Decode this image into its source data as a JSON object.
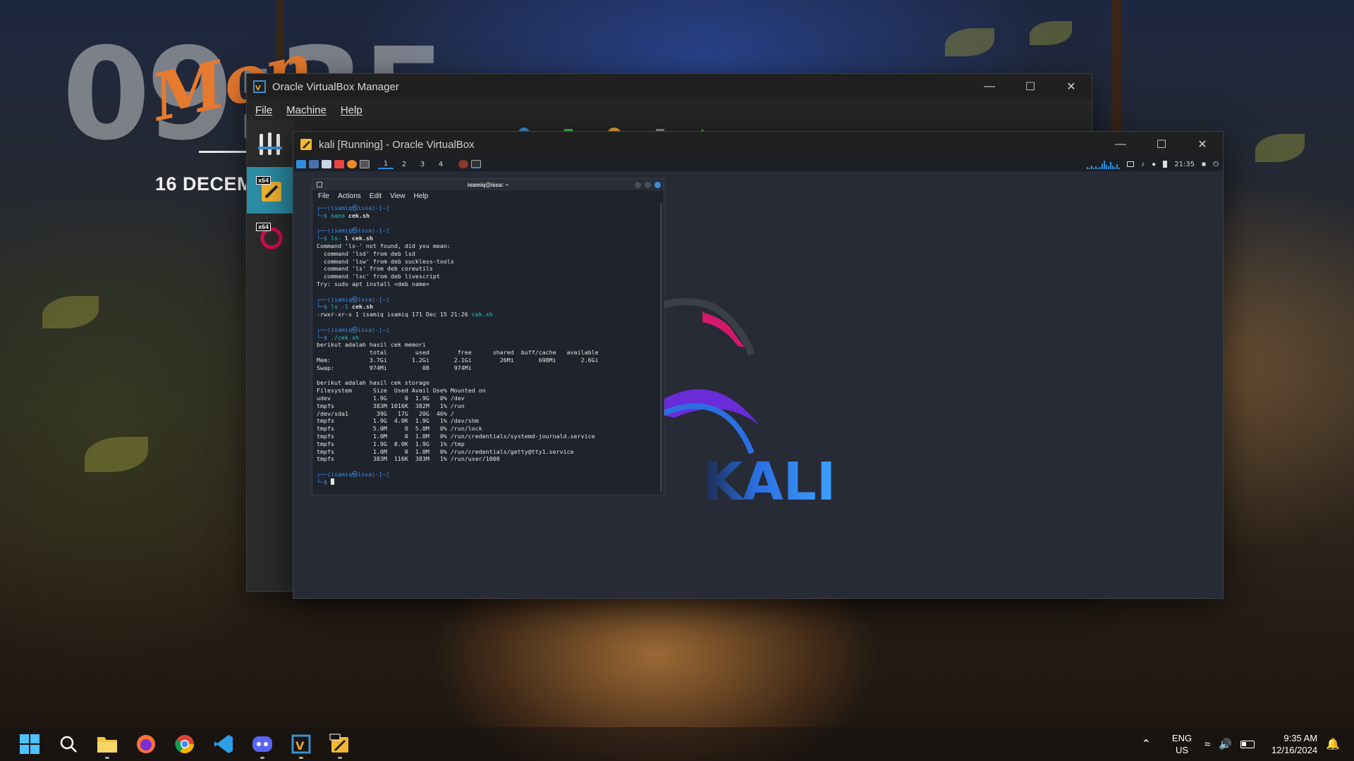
{
  "desktop": {
    "clock_digits": "09:35",
    "clock_script": "Mon",
    "date_text": "16 DECEM"
  },
  "vbox_manager": {
    "title": "Oracle VirtualBox Manager",
    "menu": [
      "File",
      "Machine",
      "Help"
    ],
    "vm_badges": [
      "x64",
      "x64"
    ]
  },
  "kali_window": {
    "title": "kali [Running] - Oracle VirtualBox",
    "panel": {
      "workspaces": [
        "1",
        "2",
        "3",
        "4"
      ],
      "time": "21:35"
    },
    "logo_text": "KALI",
    "terminal": {
      "title": "isamiq@issa: ~",
      "menu": [
        "File",
        "Actions",
        "Edit",
        "View",
        "Help"
      ],
      "lines": [
        {
          "t": "prompt",
          "text": "┌──(isamiq㉿issa)-[~]"
        },
        {
          "t": "cmd",
          "prefix": "└─$ ",
          "cmd": "nano",
          "arg": " cek.sh"
        },
        {
          "t": "blank",
          "text": ""
        },
        {
          "t": "prompt",
          "text": "┌──(isamiq㉿issa)-[~]"
        },
        {
          "t": "cmd",
          "prefix": "└─$ ",
          "cmd": "ls-",
          "arg": " l cek.sh"
        },
        {
          "t": "out",
          "text": "Command 'ls-' not found, did you mean:"
        },
        {
          "t": "out",
          "text": "  command 'lsd' from deb lsd"
        },
        {
          "t": "out",
          "text": "  command 'lsw' from deb suckless-tools"
        },
        {
          "t": "out",
          "text": "  command 'ls' from deb coreutils"
        },
        {
          "t": "out",
          "text": "  command 'lsc' from deb livescript"
        },
        {
          "t": "out",
          "text": "Try: sudo apt install <deb name>"
        },
        {
          "t": "blank",
          "text": ""
        },
        {
          "t": "prompt",
          "text": "┌──(isamiq㉿issa)-[~]"
        },
        {
          "t": "cmd",
          "prefix": "└─$ ",
          "cmd": "ls -l",
          "arg": " cek.sh"
        },
        {
          "t": "outg",
          "text": "-rwxr-xr-x 1 isamiq isamiq 171 Dec 15 21:26 ",
          "hl": "cek.sh"
        },
        {
          "t": "blank",
          "text": ""
        },
        {
          "t": "prompt",
          "text": "┌──(isamiq㉿issa)-[~]"
        },
        {
          "t": "cmd",
          "prefix": "└─$ ",
          "cmd": "./cek.sh",
          "arg": ""
        },
        {
          "t": "out",
          "text": "berikut adalah hasil cek memori"
        },
        {
          "t": "out",
          "text": "               total        used        free      shared  buff/cache   available"
        },
        {
          "t": "out",
          "text": "Mem:           3.7Gi       1.2Gi       2.1Gi        26Mi       698Mi       2.6Gi"
        },
        {
          "t": "out",
          "text": "Swap:          974Mi          0B       974Mi"
        },
        {
          "t": "blank",
          "text": ""
        },
        {
          "t": "out",
          "text": "berikut adalah hasil cek storage"
        },
        {
          "t": "out",
          "text": "Filesystem      Size  Used Avail Use% Mounted on"
        },
        {
          "t": "out",
          "text": "udev            1.9G     0  1.9G   0% /dev"
        },
        {
          "t": "out",
          "text": "tmpfs           383M 1016K  382M   1% /run"
        },
        {
          "t": "out",
          "text": "/dev/sda1        39G   17G   20G  46% /"
        },
        {
          "t": "out",
          "text": "tmpfs           1.9G  4.0K  1.9G   1% /dev/shm"
        },
        {
          "t": "out",
          "text": "tmpfs           5.0M     0  5.0M   0% /run/lock"
        },
        {
          "t": "out",
          "text": "tmpfs           1.0M     0  1.0M   0% /run/credentials/systemd-journald.service"
        },
        {
          "t": "out",
          "text": "tmpfs           1.9G  8.0K  1.9G   1% /tmp"
        },
        {
          "t": "out",
          "text": "tmpfs           1.0M     0  1.0M   0% /run/credentials/getty@tty1.service"
        },
        {
          "t": "out",
          "text": "tmpfs           383M  116K  383M   1% /run/user/1000"
        },
        {
          "t": "blank",
          "text": ""
        },
        {
          "t": "prompt",
          "text": "┌──(isamiq㉿issa)-[~]"
        },
        {
          "t": "cursor",
          "prefix": "└─$ "
        }
      ]
    }
  },
  "taskbar": {
    "apps": [
      "start-icon",
      "search-icon",
      "file-explorer-icon",
      "firefox-icon",
      "chrome-icon",
      "vscode-icon",
      "discord-icon",
      "virtualbox-manager-icon",
      "virtualbox-vm-icon"
    ],
    "lang_top": "ENG",
    "lang_bottom": "US",
    "time": "9:35 AM",
    "date": "12/16/2024"
  },
  "colors": {
    "accent": "#2c8ea6",
    "prompt": "#3b8eea",
    "kali_blue": "#2b6fe0",
    "kali_magenta": "#d4186c"
  }
}
